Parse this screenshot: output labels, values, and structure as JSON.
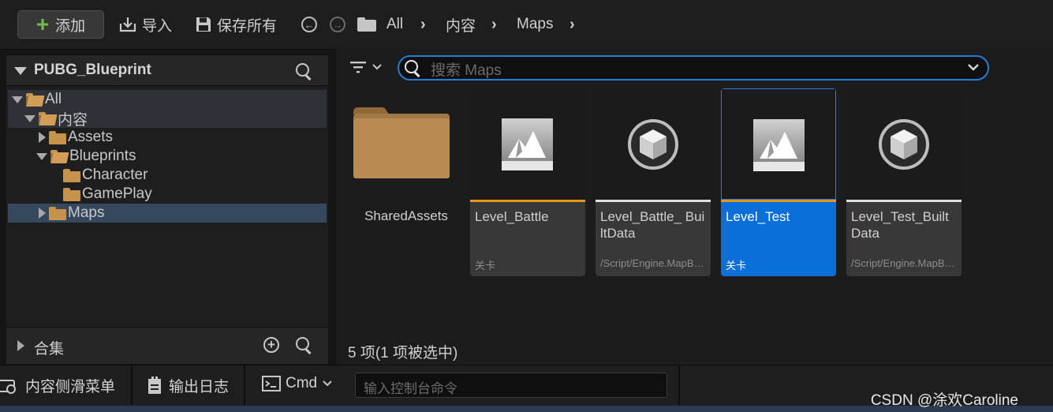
{
  "toolbar": {
    "add_label": "添加",
    "import_label": "导入",
    "save_all_label": "保存所有",
    "breadcrumb": [
      "All",
      "内容",
      "Maps"
    ]
  },
  "left_panel": {
    "title": "PUBG_Blueprint",
    "tree": [
      {
        "label": "All",
        "depth": 0,
        "expanded": true
      },
      {
        "label": "内容",
        "depth": 1,
        "expanded": true
      },
      {
        "label": "Assets",
        "depth": 2,
        "expanded": false
      },
      {
        "label": "Blueprints",
        "depth": 2,
        "expanded": true
      },
      {
        "label": "Character",
        "depth": 3,
        "expanded": false
      },
      {
        "label": "GamePlay",
        "depth": 3,
        "expanded": false
      },
      {
        "label": "Maps",
        "depth": 2,
        "expanded": false,
        "selected": true
      }
    ],
    "collections_label": "合集"
  },
  "content": {
    "search_placeholder": "搜索 Maps",
    "items": [
      {
        "name": "SharedAssets",
        "kind": "folder"
      },
      {
        "name": "Level_Battle",
        "type": "关卡",
        "kind": "level",
        "accent": "#e8951c"
      },
      {
        "name": "Level_Battle_ BuiltData",
        "type": "/Script/Engine.MapBuildDataRegistry",
        "kind": "builtdata",
        "accent": "#e0e0e0"
      },
      {
        "name": "Level_Test",
        "type": "关卡",
        "kind": "level",
        "accent": "#e8951c",
        "selected": true
      },
      {
        "name": "Level_Test_BuiltData",
        "type": "/Script/Engine.MapBuildDataRegistry",
        "kind": "builtdata",
        "accent": "#e0e0e0"
      }
    ],
    "status": "5 项(1 项被选中)"
  },
  "bottom": {
    "drawer_label": "内容侧滑菜单",
    "output_log_label": "输出日志",
    "cmd_label": "Cmd",
    "console_placeholder": "输入控制台命令"
  },
  "watermark": "CSDN @涂欢Caroline",
  "colors": {
    "accent_blue": "#0a6fd8",
    "folder": "#c6934d",
    "level_bar": "#e8951c",
    "add_plus": "#6fc043"
  }
}
